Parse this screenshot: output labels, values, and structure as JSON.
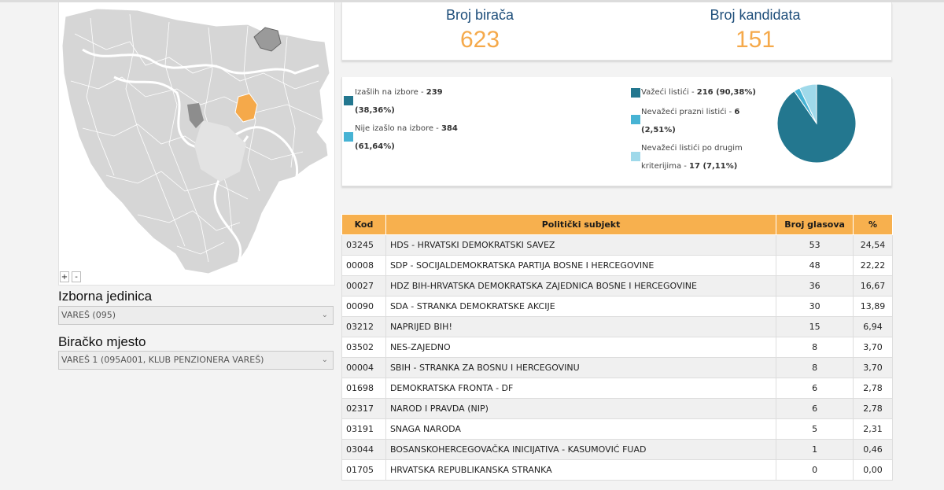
{
  "map": {
    "zoom_in": "+",
    "zoom_out": "-"
  },
  "filters": {
    "unit_label": "Izborna jedinica",
    "unit_value": "VAREŠ (095)",
    "station_label": "Biračko mjesto",
    "station_value": "VAREŠ 1 (095A001, KLUB PENZIONERA VAREŠ)"
  },
  "summary": {
    "voters_title": "Broj birača",
    "voters_value": "623",
    "candidates_title": "Broj kandidata",
    "candidates_value": "151"
  },
  "turnout": {
    "voted_label": "Izašlih na izbore - ",
    "voted_value": "239",
    "voted_pct": "(38,36%)",
    "not_voted_label": "Nije izašlo na izbore - ",
    "not_voted_value": "384",
    "not_voted_pct": "(61,64%)",
    "colors": {
      "voted": "#23778f",
      "not_voted": "#47b3d4"
    }
  },
  "ballots": {
    "valid_label": "Važeći listići - ",
    "valid_value": "216 (90,38%)",
    "blank_label": "Nevažeći prazni listići - ",
    "blank_value": "6",
    "blank_pct": "(2,51%)",
    "other_label1": "Nevažeći listići po drugim",
    "other_label2": "kriterijima - ",
    "other_value": "17 (7,11%)",
    "colors": {
      "valid": "#23778f",
      "blank": "#47b3d4",
      "other": "#9fd9ea"
    }
  },
  "chart_data": {
    "type": "pie",
    "labels": [
      "Važeći listići",
      "Nevažeći prazni listići",
      "Nevažeći listići po drugim kriterijima"
    ],
    "values": [
      216,
      6,
      17
    ],
    "colors": [
      "#23778f",
      "#47b3d4",
      "#9fd9ea"
    ]
  },
  "table": {
    "headers": [
      "Kod",
      "Politički subjekt",
      "Broj glasova",
      "%"
    ],
    "rows": [
      {
        "code": "03245",
        "name": "HDS - HRVATSKI DEMOKRATSKI SAVEZ",
        "votes": "53",
        "pct": "24,54"
      },
      {
        "code": "00008",
        "name": "SDP - SOCIJALDEMOKRATSKA PARTIJA BOSNE I HERCEGOVINE",
        "votes": "48",
        "pct": "22,22"
      },
      {
        "code": "00027",
        "name": "HDZ BIH-HRVATSKA DEMOKRATSKA ZAJEDNICA BOSNE I HERCEGOVINE",
        "votes": "36",
        "pct": "16,67"
      },
      {
        "code": "00090",
        "name": "SDA - STRANKA DEMOKRATSKE AKCIJE",
        "votes": "30",
        "pct": "13,89"
      },
      {
        "code": "03212",
        "name": "NAPRIJED BIH!",
        "votes": "15",
        "pct": "6,94"
      },
      {
        "code": "03502",
        "name": "NES-ZAJEDNO",
        "votes": "8",
        "pct": "3,70"
      },
      {
        "code": "00004",
        "name": "SBIH - STRANKA ZA BOSNU I HERCEGOVINU",
        "votes": "8",
        "pct": "3,70"
      },
      {
        "code": "01698",
        "name": "DEMOKRATSKA FRONTA - DF",
        "votes": "6",
        "pct": "2,78"
      },
      {
        "code": "02317",
        "name": "NAROD I PRAVDA (NIP)",
        "votes": "6",
        "pct": "2,78"
      },
      {
        "code": "03191",
        "name": "SNAGA NARODA",
        "votes": "5",
        "pct": "2,31"
      },
      {
        "code": "03044",
        "name": "BOSANSKOHERCEGOVAČKA INICIJATIVA - KASUMOVIĆ FUAD",
        "votes": "1",
        "pct": "0,46"
      },
      {
        "code": "01705",
        "name": "HRVATSKA REPUBLIKANSKA STRANKA",
        "votes": "0",
        "pct": "0,00"
      }
    ]
  }
}
